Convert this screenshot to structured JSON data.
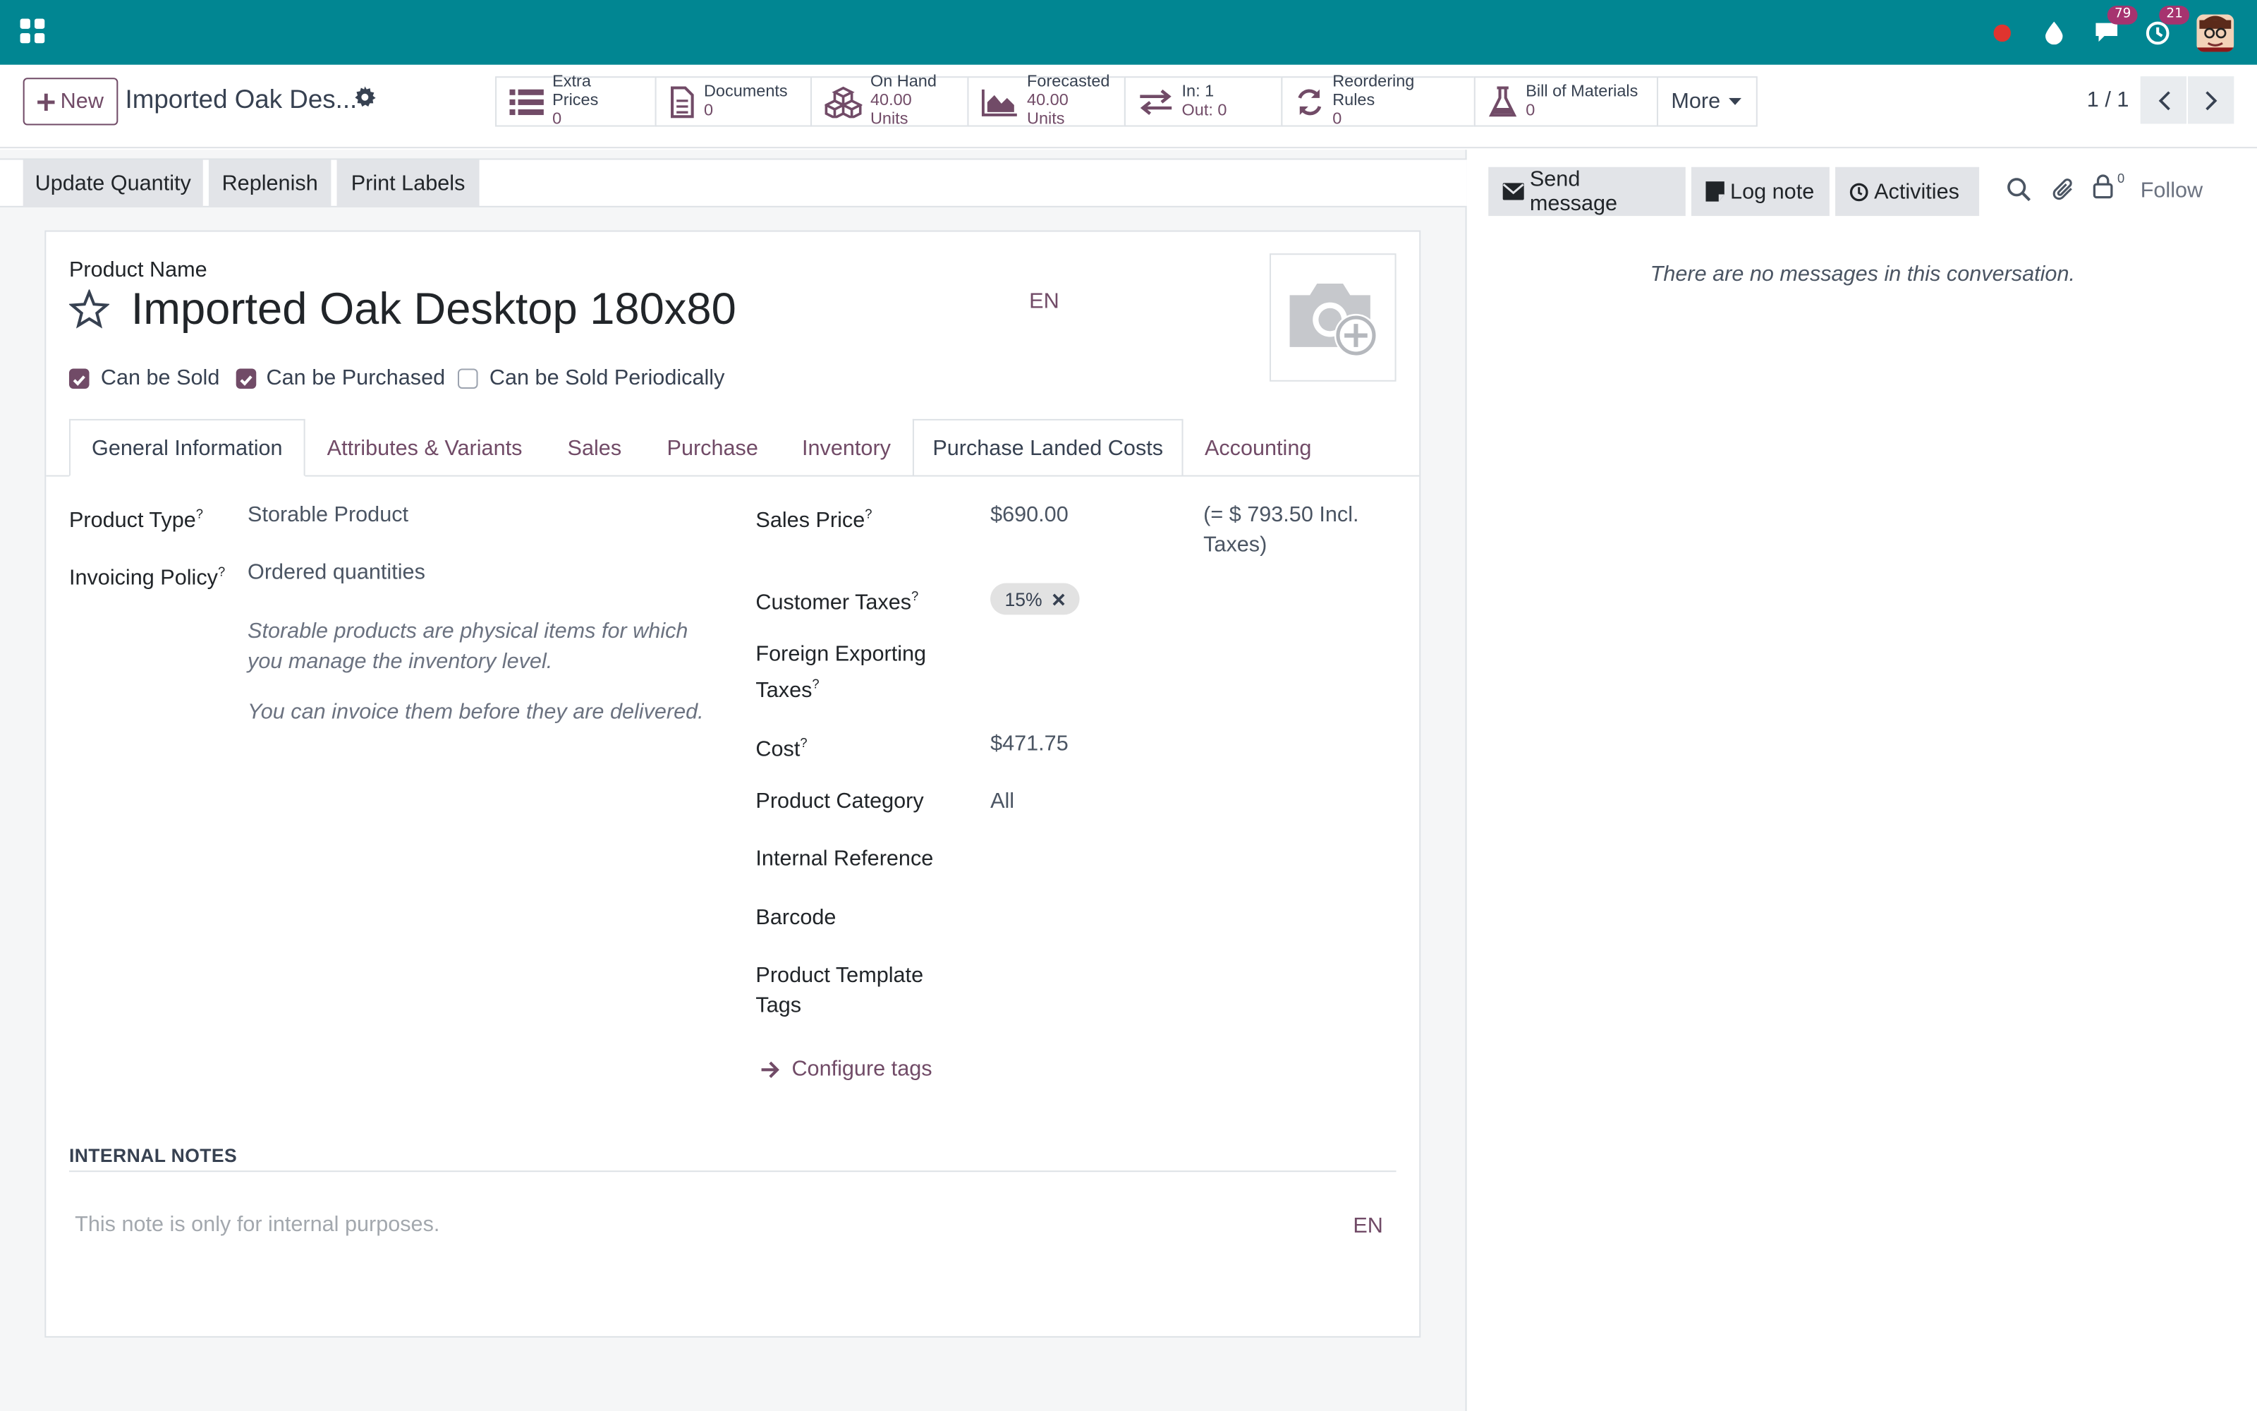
{
  "navbar": {
    "messages_count": "79",
    "activities_count": "21"
  },
  "control_panel": {
    "new_label": "New",
    "breadcrumb_title": "Imported Oak Des...",
    "smart_buttons": [
      {
        "label": "Extra Prices",
        "value": "0"
      },
      {
        "label": "Documents",
        "value": "0"
      },
      {
        "label": "On Hand",
        "value": "40.00 Units"
      },
      {
        "label": "Forecasted",
        "value": "40.00 Units"
      },
      {
        "label": "In: 1",
        "value": "Out: 0"
      },
      {
        "label": "Reordering Rules",
        "value": "0"
      },
      {
        "label": "Bill of Materials",
        "value": "0"
      }
    ],
    "more_label": "More",
    "pager": "1 / 1"
  },
  "status_buttons": [
    "Update Quantity",
    "Replenish",
    "Print Labels"
  ],
  "form": {
    "product_name_label": "Product Name",
    "product_name": "Imported Oak Desktop 180x80",
    "lang": "EN",
    "checkboxes": [
      {
        "label": "Can be Sold",
        "checked": true
      },
      {
        "label": "Can be Purchased",
        "checked": true
      },
      {
        "label": "Can be Sold Periodically",
        "checked": false
      }
    ],
    "tabs": [
      "General Information",
      "Attributes & Variants",
      "Sales",
      "Purchase",
      "Inventory",
      "Purchase Landed Costs",
      "Accounting"
    ],
    "left_fields": {
      "product_type_label": "Product Type",
      "product_type": "Storable Product",
      "invoicing_policy_label": "Invoicing Policy",
      "invoicing_policy": "Ordered quantities",
      "help_1": "Storable products are physical items for which you manage the inventory level.",
      "help_2": "You can invoice them before they are delivered."
    },
    "right_fields": {
      "sales_price_label": "Sales Price",
      "sales_price": "$690.00",
      "sales_price_incl": "(= $ 793.50 Incl. Taxes)",
      "customer_taxes_label": "Customer Taxes",
      "customer_tax_tag": "15%",
      "foreign_taxes_label": "Foreign Exporting Taxes",
      "cost_label": "Cost",
      "cost": "$471.75",
      "category_label": "Product Category",
      "category": "All",
      "internal_ref_label": "Internal Reference",
      "barcode_label": "Barcode",
      "template_tags_label": "Product Template Tags",
      "configure_tags": "Configure tags"
    },
    "help_mark": "?",
    "notes_header": "INTERNAL NOTES",
    "notes_placeholder": "This note is only for internal purposes.",
    "notes_lang": "EN"
  },
  "chatter": {
    "send_message": "Send message",
    "log_note": "Log note",
    "activities": "Activities",
    "followers_count": "0",
    "follow": "Follow",
    "empty": "There are no messages in this conversation."
  },
  "colors": {
    "navbar": "#018692",
    "primary": "#714b67",
    "badge": "#a6336f"
  }
}
